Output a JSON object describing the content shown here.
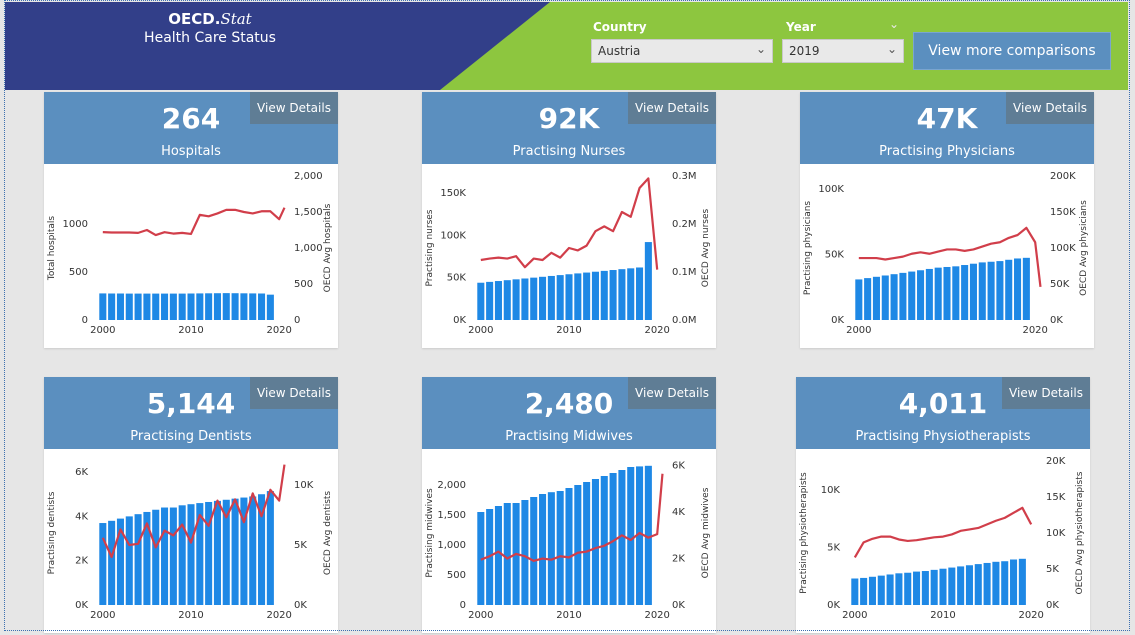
{
  "header": {
    "logo_main": "OECD.",
    "logo_italic": "Stat",
    "subtitle": "Health Care Status",
    "country_label": "Country",
    "country_value": "Austria",
    "year_label": "Year",
    "year_value": "2019",
    "compare_button": "View more comparisons",
    "colors": {
      "navy": "#323f89",
      "green": "#8dc63f",
      "card_header": "#5b8fbf",
      "view_details_bg": "#5f7d95"
    }
  },
  "icons": {
    "dropdown": "chevron-down-icon"
  },
  "cards": [
    {
      "value": "264",
      "title": "Hospitals",
      "view_details": "View Details",
      "chart_data": {
        "type": "bar+line",
        "x": [
          2000,
          2001,
          2002,
          2003,
          2004,
          2005,
          2006,
          2007,
          2008,
          2009,
          2010,
          2011,
          2012,
          2013,
          2014,
          2015,
          2016,
          2017,
          2018,
          2019
        ],
        "series": [
          {
            "axis": "left",
            "values": [
              277,
              276,
              276,
              275,
              275,
              275,
              275,
              275,
              275,
              275,
              276,
              277,
              278,
              279,
              280,
              279,
              278,
              277,
              276,
              264
            ]
          },
          {
            "axis": "right",
            "x": [
              2000,
              2001,
              2002,
              2003,
              2004,
              2005,
              2006,
              2007,
              2008,
              2009,
              2010,
              2011,
              2012,
              2013,
              2014,
              2015,
              2016,
              2017,
              2018,
              2019,
              2020
            ],
            "values": [
              1220,
              1215,
              1215,
              1215,
              1210,
              1250,
              1180,
              1220,
              1200,
              1210,
              1195,
              1460,
              1440,
              1480,
              1530,
              1530,
              1500,
              1480,
              1510,
              1510,
              1400,
              1560
            ]
          }
        ],
        "xticks": [
          "2000",
          "2010",
          "2020"
        ],
        "xlim": [
          1999,
          2021
        ],
        "ylabel_left": "Total hospitals",
        "ylabel_right": "OECD Avg hospitals",
        "yticks_left": [
          "0",
          "500",
          "1000"
        ],
        "yticks_left_values": [
          0,
          500,
          1000
        ],
        "ylim_left": [
          0,
          1500
        ],
        "yticks_right": [
          "0",
          "500",
          "1,000",
          "1,500",
          "2,000"
        ],
        "yticks_right_values": [
          0,
          500,
          1000,
          1500,
          2000
        ],
        "ylim_right": [
          0,
          2000
        ]
      }
    },
    {
      "value": "92K",
      "title": "Practising Nurses",
      "view_details": "View Details",
      "chart_data": {
        "type": "bar+line",
        "x": [
          2000,
          2001,
          2002,
          2003,
          2004,
          2005,
          2006,
          2007,
          2008,
          2009,
          2010,
          2011,
          2012,
          2013,
          2014,
          2015,
          2016,
          2017,
          2018,
          2019
        ],
        "series": [
          {
            "axis": "left",
            "values": [
              44000,
              45000,
              46000,
              47000,
              48000,
              49000,
              50000,
              51000,
              52000,
              53000,
              54000,
              55000,
              56000,
              57000,
              58000,
              59000,
              60000,
              61000,
              62000,
              92000
            ]
          },
          {
            "axis": "right",
            "x": [
              2000,
              2001,
              2002,
              2003,
              2004,
              2005,
              2006,
              2007,
              2008,
              2009,
              2010,
              2011,
              2012,
              2013,
              2014,
              2015,
              2016,
              2017,
              2018,
              2019,
              2020
            ],
            "values": [
              125000,
              128000,
              130000,
              128000,
              133000,
              110000,
              128000,
              125000,
              140000,
              130000,
              150000,
              145000,
              155000,
              185000,
              195000,
              185000,
              225000,
              215000,
              275000,
              295000,
              105000
            ]
          }
        ],
        "xticks": [
          "2000",
          "2010",
          "2020"
        ],
        "xlim": [
          1999,
          2021
        ],
        "ylabel_left": "Practising nurses",
        "ylabel_right": "OECD Avg nurses",
        "yticks_left": [
          "0K",
          "50K",
          "100K",
          "150K"
        ],
        "yticks_left_values": [
          0,
          50000,
          100000,
          150000
        ],
        "ylim_left": [
          0,
          170000
        ],
        "yticks_right": [
          "0.0M",
          "0.1M",
          "0.2M",
          "0.3M"
        ],
        "yticks_right_values": [
          0,
          100000,
          200000,
          300000
        ],
        "ylim_right": [
          0,
          300000
        ]
      }
    },
    {
      "value": "47K",
      "title": "Practising Physicians",
      "view_details": "View Details",
      "chart_data": {
        "type": "bar+line",
        "x": [
          2000,
          2001,
          2002,
          2003,
          2004,
          2005,
          2006,
          2007,
          2008,
          2009,
          2010,
          2011,
          2012,
          2013,
          2014,
          2015,
          2016,
          2017,
          2018,
          2019
        ],
        "series": [
          {
            "axis": "left",
            "values": [
              31000,
              32000,
              33000,
              34000,
              35000,
              36000,
              37000,
              38000,
              39000,
              40000,
              40500,
              41000,
              42000,
              43000,
              44000,
              44500,
              45000,
              46000,
              47000,
              47500
            ]
          },
          {
            "axis": "right",
            "x": [
              2000,
              2001,
              2002,
              2003,
              2004,
              2005,
              2006,
              2007,
              2008,
              2009,
              2010,
              2011,
              2012,
              2013,
              2014,
              2015,
              2016,
              2017,
              2018,
              2019,
              2020
            ],
            "values": [
              86000,
              86000,
              86000,
              84000,
              86000,
              88000,
              92000,
              94000,
              92000,
              95000,
              98000,
              98000,
              96000,
              98000,
              102000,
              106000,
              108000,
              114000,
              118000,
              128000,
              108000,
              46000
            ]
          }
        ],
        "xticks": [
          "2000",
          "2020"
        ],
        "xlim": [
          1999,
          2021
        ],
        "ylabel_left": "Practising physicians",
        "ylabel_right": "OECD Avg physicians",
        "yticks_left": [
          "0K",
          "50K",
          "100K"
        ],
        "yticks_left_values": [
          0,
          50000,
          100000
        ],
        "ylim_left": [
          0,
          110000
        ],
        "yticks_right": [
          "0K",
          "50K",
          "100K",
          "150K",
          "200K"
        ],
        "yticks_right_values": [
          0,
          50000,
          100000,
          150000,
          200000
        ],
        "ylim_right": [
          0,
          200000
        ]
      }
    },
    {
      "value": "5,144",
      "title": "Practising Dentists",
      "view_details": "View Details",
      "chart_data": {
        "type": "bar+line",
        "x": [
          2000,
          2001,
          2002,
          2003,
          2004,
          2005,
          2006,
          2007,
          2008,
          2009,
          2010,
          2011,
          2012,
          2013,
          2014,
          2015,
          2016,
          2017,
          2018,
          2019
        ],
        "series": [
          {
            "axis": "left",
            "values": [
              3700,
              3800,
              3900,
              4000,
              4100,
              4200,
              4300,
              4400,
              4400,
              4500,
              4550,
              4600,
              4650,
              4700,
              4750,
              4800,
              4850,
              4900,
              5000,
              5144
            ]
          },
          {
            "axis": "right",
            "x": [
              2000,
              2001,
              2002,
              2003,
              2004,
              2005,
              2006,
              2007,
              2008,
              2009,
              2010,
              2011,
              2012,
              2013,
              2014,
              2015,
              2016,
              2017,
              2018,
              2019,
              2020
            ],
            "values": [
              5600,
              4000,
              6300,
              5000,
              5100,
              6800,
              4800,
              6200,
              5800,
              6700,
              5200,
              7500,
              6600,
              8700,
              7300,
              8800,
              6900,
              9300,
              7400,
              9600,
              8700,
              11700
            ]
          }
        ],
        "xticks": [
          "2000",
          "2010",
          "2020"
        ],
        "xlim": [
          1999,
          2021
        ],
        "ylabel_left": "Practising dentists",
        "ylabel_right": "OECD Avg dentists",
        "yticks_left": [
          "0K",
          "2K",
          "4K",
          "6K"
        ],
        "yticks_left_values": [
          0,
          2000,
          4000,
          6000
        ],
        "ylim_left": [
          0,
          6500
        ],
        "yticks_right": [
          "0K",
          "5K",
          "10K"
        ],
        "yticks_right_values": [
          0,
          5000,
          10000
        ],
        "ylim_right": [
          0,
          12000
        ]
      }
    },
    {
      "value": "2,480",
      "title": "Practising Midwives",
      "view_details": "View Details",
      "chart_data": {
        "type": "bar+line",
        "x": [
          2000,
          2001,
          2002,
          2003,
          2004,
          2005,
          2006,
          2007,
          2008,
          2009,
          2010,
          2011,
          2012,
          2013,
          2014,
          2015,
          2016,
          2017,
          2018,
          2019
        ],
        "series": [
          {
            "axis": "left",
            "values": [
              1550,
              1600,
              1650,
              1700,
              1700,
              1750,
              1800,
              1850,
              1880,
              1900,
              1950,
              2000,
              2050,
              2100,
              2150,
              2200,
              2250,
              2300,
              2310,
              2320
            ]
          },
          {
            "axis": "right",
            "x": [
              2000,
              2001,
              2002,
              2003,
              2004,
              2005,
              2006,
              2007,
              2008,
              2009,
              2010,
              2011,
              2012,
              2013,
              2014,
              2015,
              2016,
              2017,
              2018,
              2019,
              2020
            ],
            "values": [
              1950,
              2100,
              2300,
              2000,
              2200,
              2100,
              1900,
              2000,
              1950,
              2100,
              2050,
              2250,
              2300,
              2450,
              2550,
              2750,
              3000,
              2800,
              3100,
              2900,
              3050,
              5650
            ]
          }
        ],
        "xticks": [
          "2000",
          "2010",
          "2020"
        ],
        "xlim": [
          1999,
          2021
        ],
        "ylabel_left": "Practising midwives",
        "ylabel_right": "OECD Avg midwives",
        "yticks_left": [
          "0",
          "500",
          "1,000",
          "1,500",
          "2,000"
        ],
        "yticks_left_values": [
          0,
          500,
          1000,
          1500,
          2000
        ],
        "ylim_left": [
          0,
          2400
        ],
        "yticks_right": [
          "0K",
          "2K",
          "4K",
          "6K"
        ],
        "yticks_right_values": [
          0,
          2000,
          4000,
          6000
        ],
        "ylim_right": [
          0,
          6200
        ]
      }
    },
    {
      "value": "4,011",
      "title": "Practising Physiotherapists",
      "view_details": "View Details",
      "chart_data": {
        "type": "bar+line",
        "x": [
          2000,
          2001,
          2002,
          2003,
          2004,
          2005,
          2006,
          2007,
          2008,
          2009,
          2010,
          2011,
          2012,
          2013,
          2014,
          2015,
          2016,
          2017,
          2018,
          2019
        ],
        "series": [
          {
            "axis": "left",
            "values": [
              2300,
              2350,
              2450,
              2550,
              2650,
              2750,
              2800,
              2900,
              2950,
              3050,
              3150,
              3250,
              3350,
              3450,
              3550,
              3650,
              3750,
              3800,
              3950,
              4011
            ]
          },
          {
            "axis": "right",
            "x": [
              2000,
              2001,
              2002,
              2003,
              2004,
              2005,
              2006,
              2007,
              2008,
              2009,
              2010,
              2011,
              2012,
              2013,
              2014,
              2015,
              2016,
              2017,
              2018,
              2019,
              2020
            ],
            "values": [
              6600,
              8700,
              9200,
              9500,
              9500,
              9100,
              8900,
              9000,
              9200,
              9400,
              9500,
              9800,
              10300,
              10500,
              10700,
              11200,
              11700,
              12100,
              12800,
              13500,
              11200
            ]
          }
        ],
        "xticks": [
          "2000",
          "2010",
          "2020"
        ],
        "xlim": [
          1999,
          2021
        ],
        "ylabel_left": "Practising physiotherapists",
        "ylabel_right": "OECD Avg physiotherapists",
        "yticks_left": [
          "0K",
          "5K",
          "10K"
        ],
        "yticks_left_values": [
          0,
          5000,
          10000
        ],
        "ylim_left": [
          0,
          12500
        ],
        "yticks_right": [
          "0K",
          "5K",
          "10K",
          "15K",
          "20K"
        ],
        "yticks_right_values": [
          0,
          5000,
          10000,
          15000,
          20000
        ],
        "ylim_right": [
          0,
          20000
        ]
      }
    }
  ]
}
